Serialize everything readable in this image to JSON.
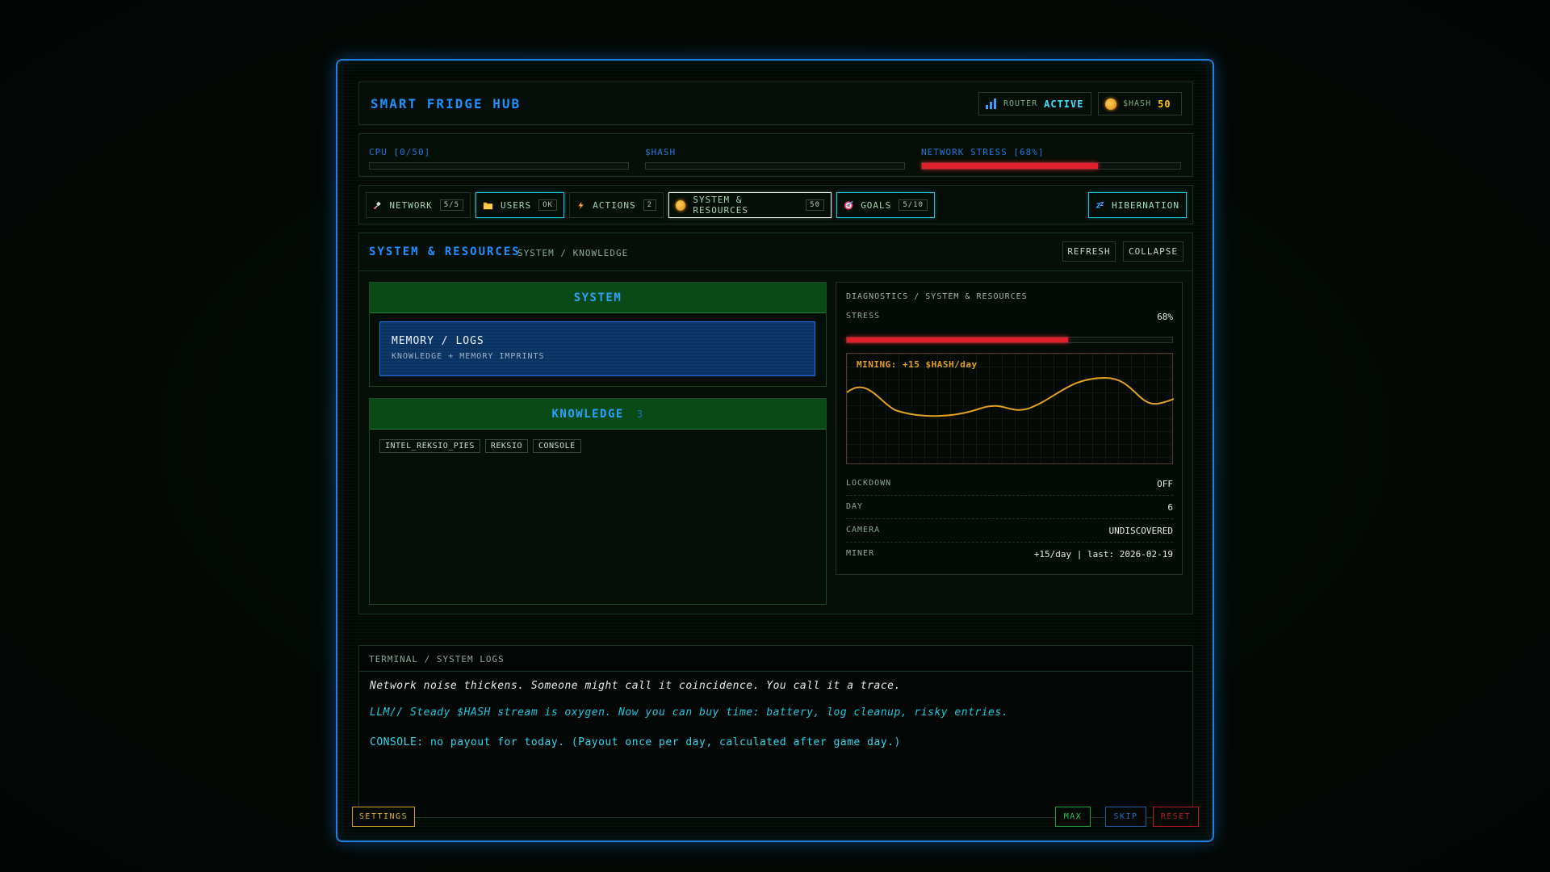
{
  "app": {
    "title": "SMART FRIDGE HUB",
    "router_label": "ROUTER",
    "router_value": "ACTIVE",
    "hash_label": "$HASH",
    "hash_value": "50"
  },
  "meters": {
    "cpu_label": "CPU [0/50]",
    "cpu_fraction": 0,
    "hash_label": "$HASH",
    "hash_fraction": 0,
    "stress_label": "NETWORK STRESS [68%]",
    "stress_fraction": 0.68
  },
  "tabs": [
    {
      "label": "NETWORK",
      "badge": "5/5",
      "icon": "satellite-icon"
    },
    {
      "label": "USERS",
      "badge": "OK",
      "icon": "folder-icon"
    },
    {
      "label": "ACTIONS",
      "badge": "2",
      "icon": "lightning-icon"
    },
    {
      "label": "SYSTEM & RESOURCES",
      "badge": "50",
      "icon": "coin-icon"
    },
    {
      "label": "GOALS",
      "badge": "5/10",
      "icon": "target-icon"
    }
  ],
  "hibernation_label": "HIBERNATION",
  "section": {
    "title": "SYSTEM & RESOURCES",
    "breadcrumb": "SYSTEM / KNOWLEDGE",
    "refresh_label": "REFRESH",
    "collapse_label": "COLLAPSE"
  },
  "system": {
    "heading": "SYSTEM",
    "item_title": "MEMORY / LOGS",
    "item_subtitle": "KNOWLEDGE + MEMORY IMPRINTS"
  },
  "knowledge": {
    "heading": "KNOWLEDGE",
    "count": "3",
    "tags": [
      "INTEL_REKSIO_PIES",
      "REKSIO",
      "CONSOLE"
    ]
  },
  "diagnostics": {
    "title": "DIAGNOSTICS / SYSTEM & RESOURCES",
    "stress_label": "STRESS",
    "stress_value": "68%",
    "stress_fraction": 0.68,
    "mining_label": "MINING: +15 $HASH/day",
    "rows": [
      {
        "key": "LOCKDOWN",
        "value": "OFF"
      },
      {
        "key": "DAY",
        "value": "6"
      },
      {
        "key": "CAMERA",
        "value": "UNDISCOVERED"
      },
      {
        "key": "MINER",
        "value": "+15/day | last: 2026-02-19"
      }
    ]
  },
  "terminal": {
    "title": "TERMINAL / SYSTEM LOGS",
    "lines": [
      "Network noise thickens. Someone might call it coincidence. You call it a trace.",
      "LLM// Steady $HASH stream is oxygen. Now you can buy time: battery, log cleanup, risky entries.",
      "CONSOLE: no payout for today. (Payout once per day, calculated after game day.)"
    ]
  },
  "footer": {
    "settings_label": "SETTINGS",
    "max_label": "MAX",
    "skip_label": "SKIP",
    "reset_label": "RESET"
  },
  "colors": {
    "accent_blue": "#1e90ff",
    "stress_red": "#e0202a",
    "hash_gold": "#ffc400",
    "cyan": "#3ee0ff",
    "mining_curve": "#e0a020"
  }
}
